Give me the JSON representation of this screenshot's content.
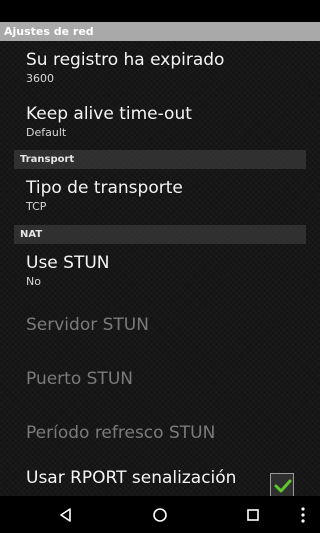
{
  "header": {
    "title": "Ajustes de red"
  },
  "preferences": [
    {
      "title": "Su registro ha expirado",
      "summary": "3600"
    },
    {
      "title": "Keep alive time-out",
      "summary": "Default"
    }
  ],
  "categories": {
    "transport": "Transport",
    "nat": "NAT"
  },
  "transport": {
    "title": "Tipo de transporte",
    "summary": "TCP"
  },
  "nat": {
    "use_stun": {
      "title": "Use STUN",
      "summary": "No"
    },
    "servidor_stun": "Servidor STUN",
    "puerto_stun": "Puerto STUN",
    "periodo_refresco": "Período refresco STUN",
    "usar_rport": {
      "title": "Usar RPORT senalización",
      "checked": true
    }
  },
  "colors": {
    "checkmark": "#5ec72d",
    "title_bar": "#a9a9a9"
  },
  "navigation": {
    "back": "back-icon",
    "home": "home-icon",
    "recents": "recents-icon",
    "menu": "overflow-menu-icon"
  }
}
